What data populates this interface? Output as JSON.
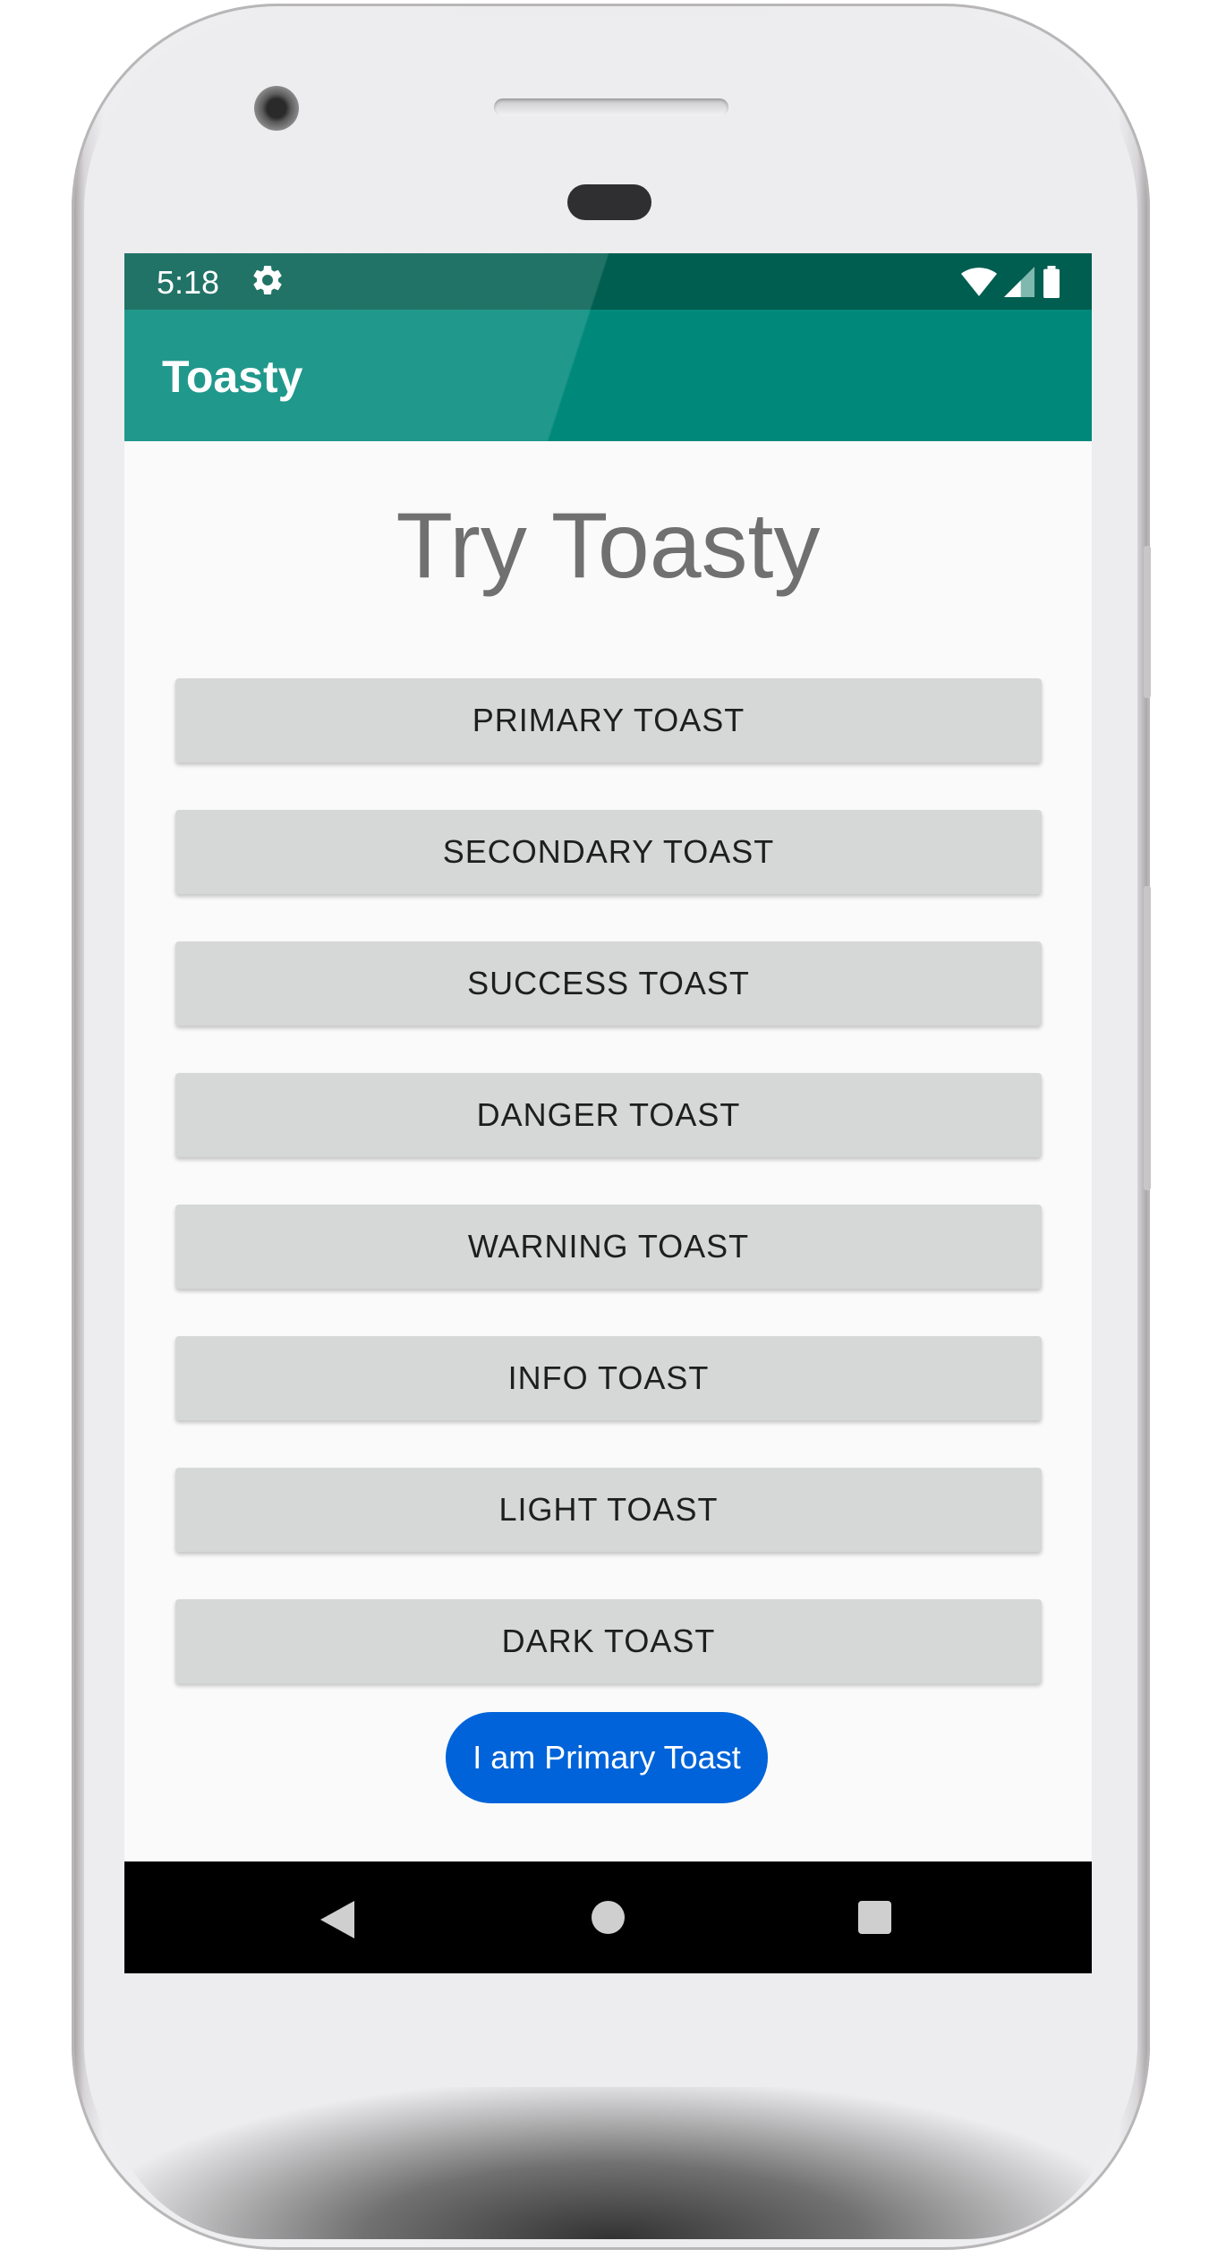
{
  "status_bar": {
    "time": "5:18",
    "icons": [
      "gear-icon",
      "wifi-icon",
      "signal-icon",
      "battery-icon"
    ]
  },
  "app_bar": {
    "title": "Toasty"
  },
  "main": {
    "heading": "Try Toasty",
    "buttons": [
      {
        "label": "PRIMARY TOAST"
      },
      {
        "label": "SECONDARY TOAST"
      },
      {
        "label": "SUCCESS TOAST"
      },
      {
        "label": "DANGER TOAST"
      },
      {
        "label": "WARNING TOAST"
      },
      {
        "label": "INFO TOAST"
      },
      {
        "label": "LIGHT TOAST"
      },
      {
        "label": "DARK TOAST"
      }
    ],
    "toast": {
      "message": "I am Primary Toast",
      "color": "#0063d9"
    }
  },
  "nav_bar": {
    "icons": [
      "back-icon",
      "home-icon",
      "recents-icon"
    ]
  },
  "colors": {
    "primary": "#00897b",
    "primary_dark": "#005e50",
    "button_bg": "#d6d7d7"
  }
}
